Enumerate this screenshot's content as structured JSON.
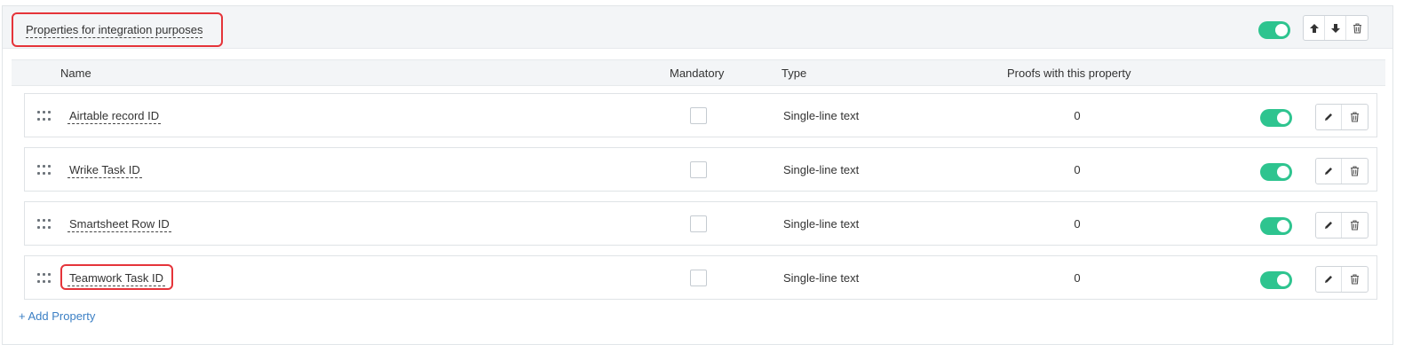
{
  "group": {
    "title": "Properties for integration purposes",
    "enabled": true
  },
  "header_actions": {
    "icons": [
      "arrow-up-icon",
      "arrow-down-icon",
      "trash-icon"
    ]
  },
  "table": {
    "columns": {
      "name": "Name",
      "mandatory": "Mandatory",
      "type": "Type",
      "proofs": "Proofs with this property"
    },
    "rows": [
      {
        "name": "Airtable record ID",
        "mandatory": false,
        "type": "Single-line text",
        "proofs": "0",
        "enabled": true
      },
      {
        "name": "Wrike Task ID",
        "mandatory": false,
        "type": "Single-line text",
        "proofs": "0",
        "enabled": true
      },
      {
        "name": "Smartsheet Row ID",
        "mandatory": false,
        "type": "Single-line text",
        "proofs": "0",
        "enabled": true
      },
      {
        "name": "Teamwork Task ID",
        "mandatory": false,
        "type": "Single-line text",
        "proofs": "0",
        "enabled": true
      }
    ]
  },
  "add_property_label": "+ Add Property",
  "colors": {
    "accent_green": "#2ec48f",
    "link_blue": "#3b7fc4",
    "highlight_red": "#e5343a"
  }
}
